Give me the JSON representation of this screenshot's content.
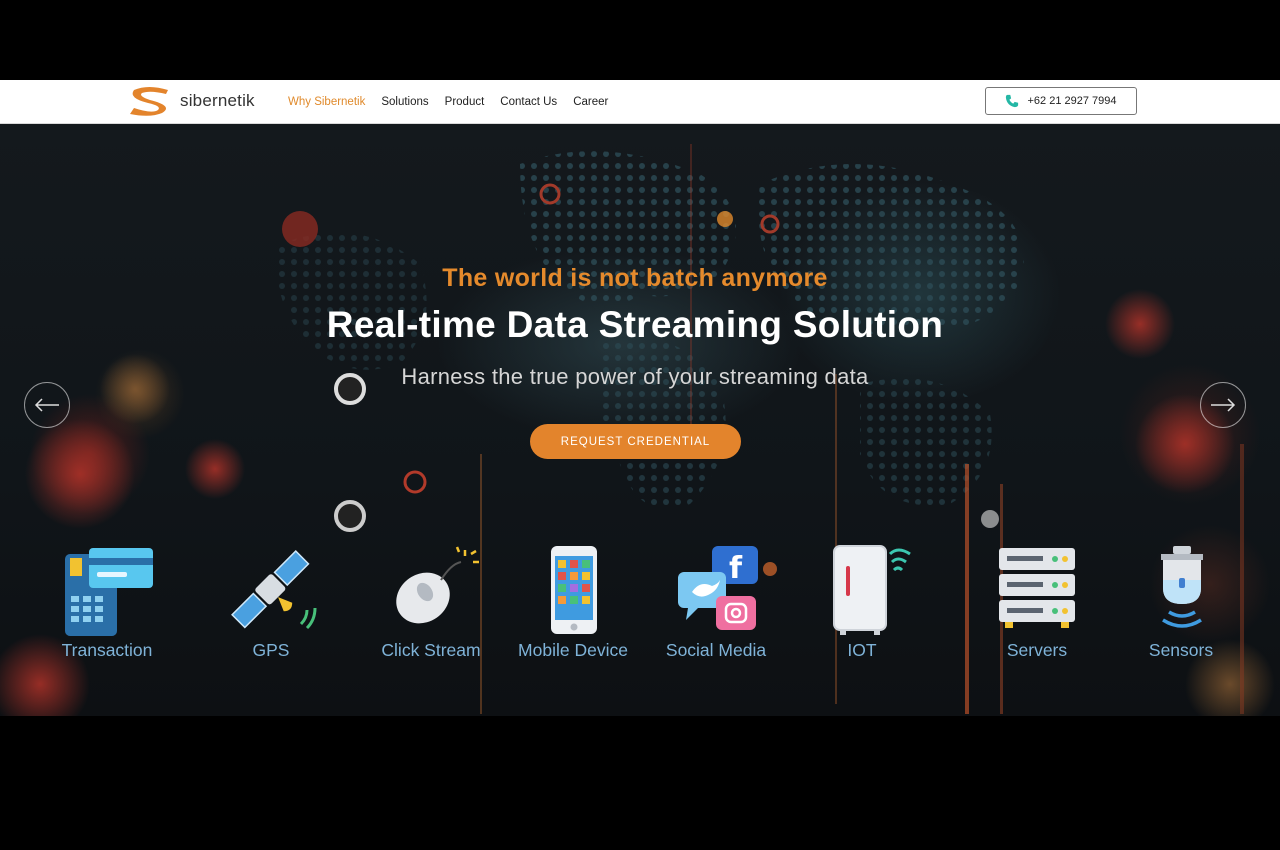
{
  "brand": {
    "name": "sibernetik",
    "accent_color": "#e08a2c"
  },
  "nav": {
    "links": [
      {
        "label": "Why Sibernetik",
        "active": true
      },
      {
        "label": "Solutions",
        "active": false
      },
      {
        "label": "Product",
        "active": false
      },
      {
        "label": "Contact Us",
        "active": false
      },
      {
        "label": "Career",
        "active": false
      }
    ],
    "phone": {
      "icon": "phone-icon",
      "number": "+62 21 2927 7994"
    }
  },
  "hero": {
    "tagline": "The world is not batch anymore",
    "headline": "Real-time Data Streaming Solution",
    "subline": "Harness the true power of your streaming data",
    "cta_label": "REQUEST CREDENTIAL",
    "cta_color": "#e3842c",
    "prev_icon": "arrow-left-icon",
    "next_icon": "arrow-right-icon"
  },
  "sources": [
    {
      "label": "Transaction",
      "icon": "transaction-icon"
    },
    {
      "label": "GPS",
      "icon": "satellite-icon"
    },
    {
      "label": "Click Stream",
      "icon": "mouse-icon"
    },
    {
      "label": "Mobile Device",
      "icon": "smartphone-icon"
    },
    {
      "label": "Social Media",
      "icon": "social-media-icon"
    },
    {
      "label": "IOT",
      "icon": "fridge-wifi-icon"
    },
    {
      "label": "Servers",
      "icon": "server-rack-icon"
    },
    {
      "label": "Sensors",
      "icon": "sensor-icon"
    }
  ]
}
